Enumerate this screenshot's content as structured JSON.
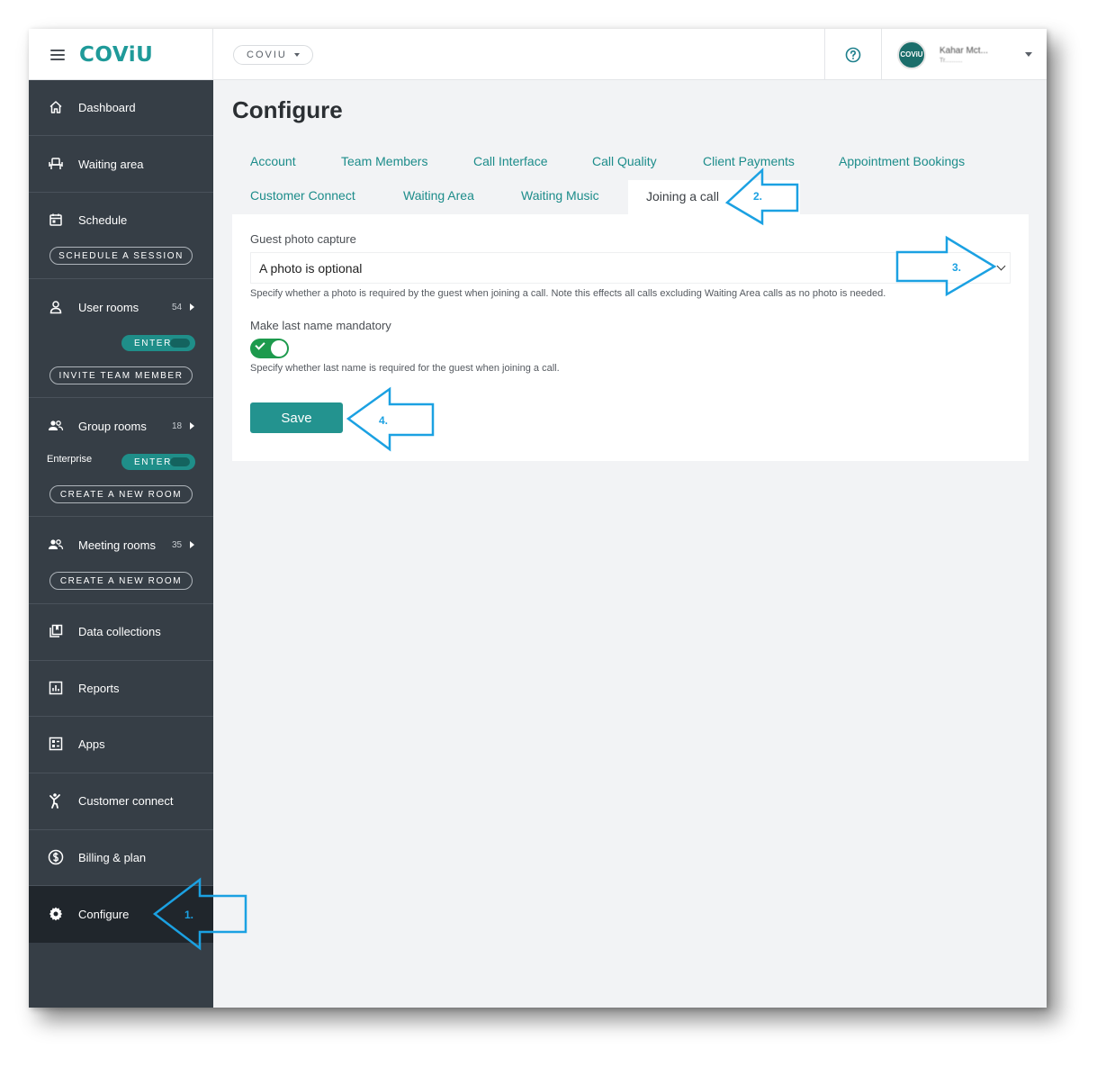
{
  "topbar": {
    "brand": "COViU",
    "org_selector": "COVIU",
    "user_name": "Kahar Mct...",
    "user_org": "Tr..........",
    "avatar_text": "COViU"
  },
  "sidebar": {
    "dashboard": "Dashboard",
    "waiting_area": "Waiting area",
    "schedule": "Schedule",
    "schedule_btn": "SCHEDULE A SESSION",
    "user_rooms": "User rooms",
    "user_rooms_count": "54",
    "enter_label": "ENTER",
    "invite_btn": "INVITE TEAM MEMBER",
    "group_rooms": "Group rooms",
    "group_rooms_count": "18",
    "enterprise": "Enterprise",
    "create_room_btn": "CREATE A NEW ROOM",
    "meeting_rooms": "Meeting rooms",
    "meeting_rooms_count": "35",
    "data_collections": "Data collections",
    "reports": "Reports",
    "apps": "Apps",
    "customer_connect": "Customer connect",
    "billing": "Billing & plan",
    "configure": "Configure"
  },
  "main": {
    "title": "Configure",
    "tabs": {
      "account": "Account",
      "team_members": "Team Members",
      "call_interface": "Call Interface",
      "call_quality": "Call Quality",
      "client_payments": "Client Payments",
      "appointment_bookings": "Appointment Bookings",
      "customer_connect": "Customer Connect",
      "waiting_area": "Waiting Area",
      "waiting_music": "Waiting Music",
      "joining_a_call": "Joining a call"
    },
    "guest_photo_label": "Guest photo capture",
    "guest_photo_value": "A photo is optional",
    "guest_photo_help": "Specify whether a photo is required by the guest when joining a call. Note this effects all calls excluding Waiting Area calls as no photo is needed.",
    "last_name_label": "Make last name mandatory",
    "last_name_enabled": true,
    "last_name_help": "Specify whether last name is required for the guest when joining a call.",
    "save_label": "Save"
  },
  "annotations": {
    "step1": "1.",
    "step2": "2.",
    "step3": "3.",
    "step4": "4."
  },
  "colors": {
    "accent": "#1c8c8a",
    "sidebar": "#363e46",
    "sidebar_active": "#20262c",
    "toggle_on": "#1d9a4d",
    "annotation": "#1ba1e2"
  }
}
